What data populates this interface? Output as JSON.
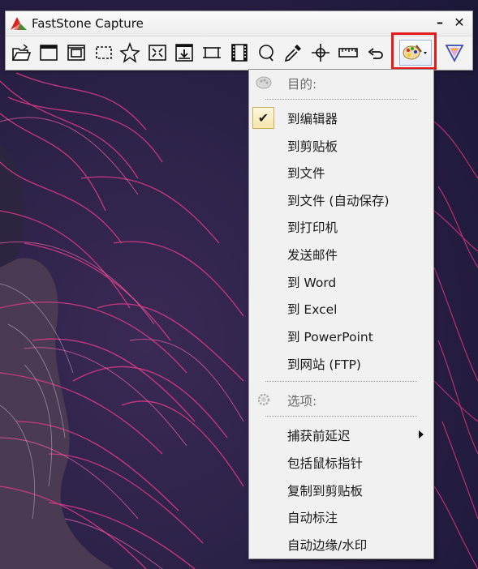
{
  "window": {
    "title": "FastStone Capture",
    "minimize_label": "–",
    "close_label": "✕"
  },
  "toolbar": {
    "tools": [
      {
        "icon": "open-folder-icon"
      },
      {
        "icon": "capture-active-window-icon"
      },
      {
        "icon": "capture-window-object-icon"
      },
      {
        "icon": "capture-rectangle-icon"
      },
      {
        "icon": "capture-freehand-icon"
      },
      {
        "icon": "capture-fullscreen-icon"
      },
      {
        "icon": "capture-scrolling-window-icon"
      },
      {
        "icon": "capture-fixed-region-icon"
      },
      {
        "icon": "screen-recorder-icon"
      },
      {
        "icon": "magnifier-icon"
      },
      {
        "icon": "color-picker-icon"
      },
      {
        "icon": "crosshair-icon"
      },
      {
        "icon": "screen-ruler-icon"
      },
      {
        "icon": "undo-icon"
      }
    ],
    "destination_icon": "palette-icon",
    "settings_icon": "settings-triangle-icon"
  },
  "callout": {
    "text": "目的"
  },
  "menu": {
    "destination_header": "目的:",
    "destinations": [
      {
        "label": "到编辑器",
        "checked": true
      },
      {
        "label": "到剪贴板",
        "checked": false
      },
      {
        "label": "到文件",
        "checked": false
      },
      {
        "label": "到文件 (自动保存)",
        "checked": false
      },
      {
        "label": "到打印机",
        "checked": false
      },
      {
        "label": "发送邮件",
        "checked": false
      },
      {
        "label": "到 Word",
        "checked": false
      },
      {
        "label": "到 Excel",
        "checked": false
      },
      {
        "label": "到 PowerPoint",
        "checked": false
      },
      {
        "label": "到网站 (FTP)",
        "checked": false
      }
    ],
    "options_header": "选项:",
    "options": [
      {
        "label": "捕获前延迟",
        "has_submenu": true
      },
      {
        "label": "包括鼠标指针",
        "has_submenu": false
      },
      {
        "label": "复制到剪贴板",
        "has_submenu": false
      },
      {
        "label": "自动标注",
        "has_submenu": false
      },
      {
        "label": "自动边缘/水印",
        "has_submenu": false
      }
    ]
  },
  "colors": {
    "highlight": "#e51a1a",
    "background": "#1f1a3a",
    "hair": "#d2307a"
  }
}
